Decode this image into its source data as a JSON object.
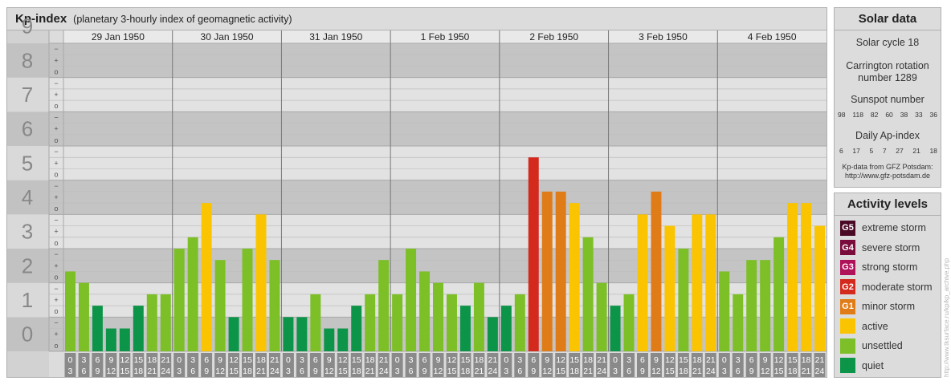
{
  "main_panel": {
    "title": "Kp-index",
    "subtitle": "(planetary 3-hourly index of geomagnetic activity)"
  },
  "chart_data": {
    "type": "bar",
    "y_range": [
      0,
      9
    ],
    "y_tick_labels": [
      "0",
      "1",
      "2",
      "3",
      "4",
      "5",
      "6",
      "7",
      "8",
      "9"
    ],
    "y_sublabels": [
      "o",
      "+",
      "−"
    ],
    "days": [
      "29 Jan 1950",
      "30 Jan 1950",
      "31 Jan 1950",
      "1 Feb 1950",
      "2 Feb 1950",
      "3 Feb 1950",
      "4 Feb 1950"
    ],
    "interval_labels": [
      [
        "0",
        "3"
      ],
      [
        "3",
        "6"
      ],
      [
        "6",
        "9"
      ],
      [
        "9",
        "12"
      ],
      [
        "12",
        "15"
      ],
      [
        "15",
        "18"
      ],
      [
        "18",
        "21"
      ],
      [
        "21",
        "24"
      ]
    ],
    "values": [
      2.333,
      2.0,
      1.333,
      0.667,
      0.667,
      1.333,
      1.667,
      1.667,
      3.0,
      3.333,
      4.333,
      2.667,
      1.0,
      3.0,
      4.0,
      2.667,
      1.0,
      1.0,
      1.667,
      0.667,
      0.667,
      1.333,
      1.667,
      2.667,
      1.667,
      3.0,
      2.333,
      2.0,
      1.667,
      1.333,
      2.0,
      1.0,
      1.333,
      1.667,
      5.667,
      4.667,
      4.667,
      4.333,
      3.333,
      2.0,
      1.333,
      1.667,
      4.0,
      4.667,
      3.667,
      3.0,
      4.0,
      4.0,
      2.333,
      1.667,
      2.667,
      2.667,
      3.333,
      4.333,
      4.333,
      3.667
    ],
    "grid": true,
    "legend": "right"
  },
  "solar_data": {
    "title": "Solar data",
    "cycle": "Solar cycle 18",
    "carrington_line1": "Carrington rotation",
    "carrington_line2": "number 1289",
    "sunspot_title": "Sunspot number",
    "sunspot_numbers": [
      "98",
      "118",
      "82",
      "60",
      "38",
      "33",
      "36"
    ],
    "ap_title": "Daily Ap-index",
    "ap_numbers": [
      "6",
      "17",
      "5",
      "7",
      "27",
      "21",
      "18"
    ],
    "source_line1": "Kp-data from GFZ Potsdam:",
    "source_line2": "http://www.gfz-potsdam.de"
  },
  "activity_levels": {
    "title": "Activity levels",
    "items": [
      {
        "code": "G5",
        "label": "extreme storm",
        "color": "#4a0a26"
      },
      {
        "code": "G4",
        "label": "severe storm",
        "color": "#7a0c3c"
      },
      {
        "code": "G3",
        "label": "strong storm",
        "color": "#b0125a"
      },
      {
        "code": "G2",
        "label": "moderate storm",
        "color": "#d42a1e"
      },
      {
        "code": "G1",
        "label": "minor storm",
        "color": "#e07c18"
      },
      {
        "code": "",
        "label": "active",
        "color": "#fbc400"
      },
      {
        "code": "",
        "label": "unsettled",
        "color": "#7cbf26"
      },
      {
        "code": "",
        "label": "quiet",
        "color": "#0c9448"
      }
    ]
  },
  "credit": "http://www.tksurface.ru/kp/kp_archive.php"
}
